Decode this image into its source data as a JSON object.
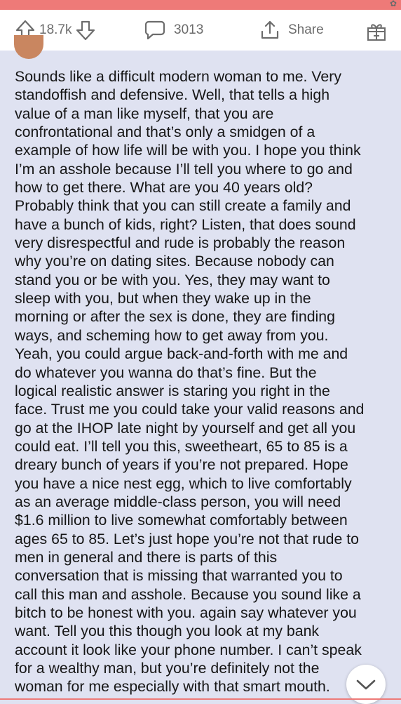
{
  "status": {
    "corner_icon": "partial-emoji-icon"
  },
  "action_bar": {
    "upvote_icon": "arrow-up-icon",
    "score": "18.7k",
    "downvote_icon": "arrow-down-icon",
    "comment_icon": "speech-bubble-icon",
    "comment_count": "3013",
    "share_icon": "share-upload-icon",
    "share_label": "Share",
    "award_icon": "gift-box-icon"
  },
  "comment": {
    "avatar_icon": "user-avatar",
    "text": "Sounds like a difficult modern woman to me.  Very\nstandoffish and defensive.  Well, that tells a high\nvalue of a man like myself, that you are\nconfrontational and that’s only a smidgen of a\nexample of how life will be with you. I hope you think\nI’m an asshole because I’ll tell you where to go and\nhow to get there. What are you 40 years old?\nProbably think that you can still create a family and\nhave a bunch of kids, right? Listen, that does sound\nvery disrespectful and rude is probably the reason\nwhy you’re on dating sites. Because nobody can\nstand you or be with you. Yes, they may want to\nsleep with you, but when they wake up in the\nmorning or after the sex is done, they are finding\nways, and scheming how to get away from you.\nYeah, you could argue back-and-forth with me and\ndo whatever you wanna do that’s fine. But the\nlogical realistic answer is staring you right in the\nface. Trust me you could take your valid reasons and\ngo at the IHOP late night by yourself and get all you\ncould eat. I’ll tell you this, sweetheart, 65 to 85 is a\ndreary bunch of years if you’re not prepared. Hope\nyou have a nice nest egg, which to live comfortably\nas an average middle-class person, you will need\n$1.6 million to live somewhat comfortably between\nages 65 to 85. Let’s just hope you’re not that rude to\nmen in general and there is parts of this\nconversation that is missing that warranted you to\ncall this man and asshole. Because you sound like a\nbitch to be honest with you. again say whatever you\nwant. Tell you this though you look at my bank\naccount it look like your phone number. I can’t speak\nfor a wealthy man, but you’re definitely not the\nwoman for me especially with that smart mouth."
  },
  "scroll_button": {
    "icon": "chevron-down-icon"
  }
}
